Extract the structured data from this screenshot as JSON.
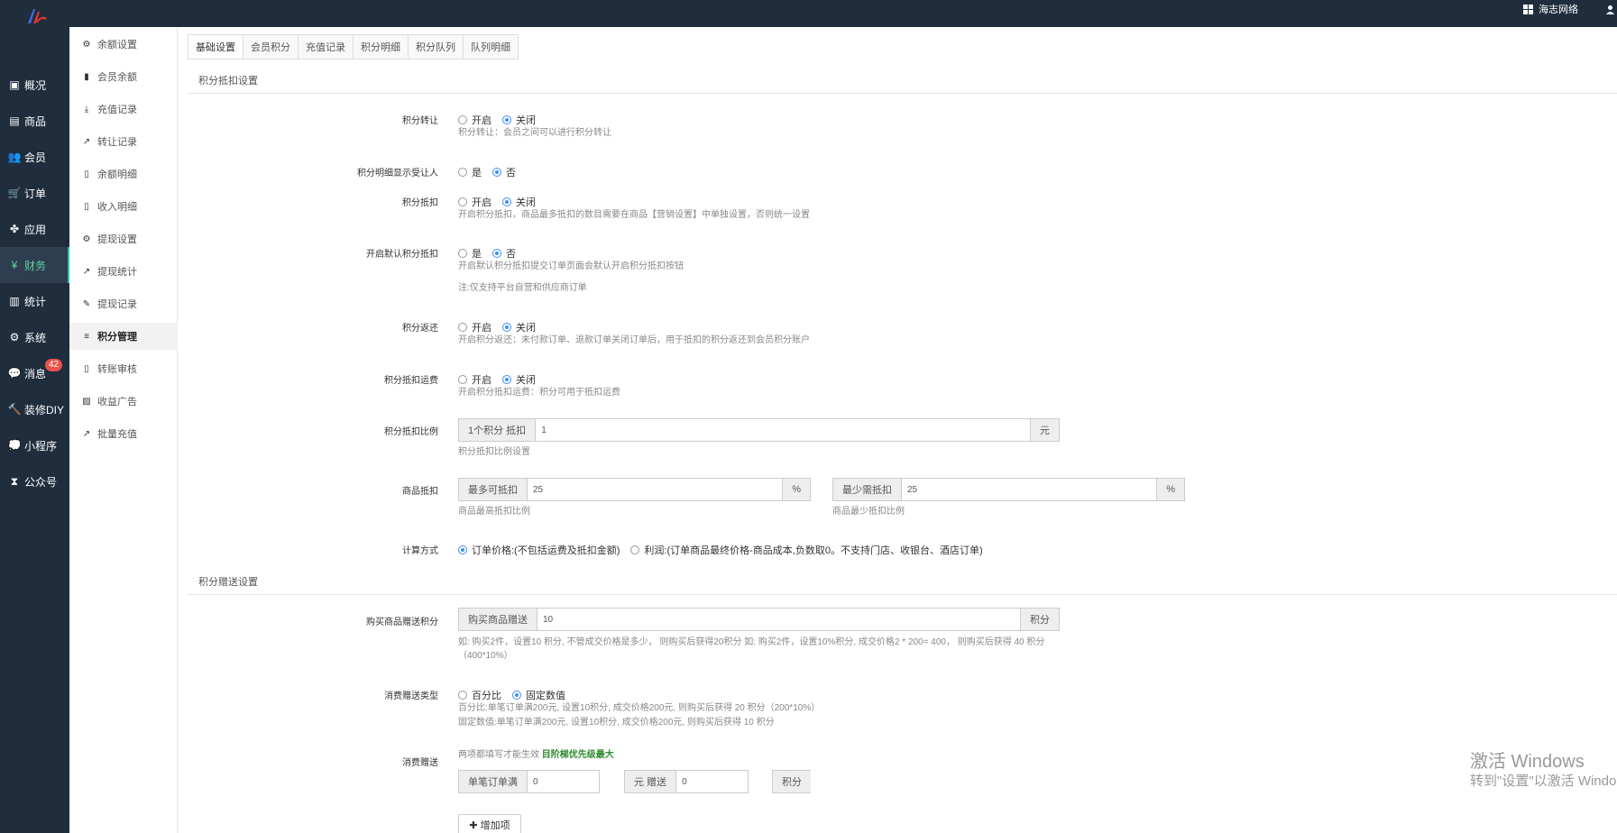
{
  "topbar": {
    "brand_link": "海志网络"
  },
  "nav": [
    {
      "label": "概况",
      "icon": "dashboard-icon"
    },
    {
      "label": "商品",
      "icon": "goods-icon"
    },
    {
      "label": "会员",
      "icon": "users-icon"
    },
    {
      "label": "订单",
      "icon": "cart-icon"
    },
    {
      "label": "应用",
      "icon": "apps-icon"
    },
    {
      "label": "财务",
      "icon": "yen-icon"
    },
    {
      "label": "统计",
      "icon": "chart-icon"
    },
    {
      "label": "系统",
      "icon": "cogs-icon"
    },
    {
      "label": "消息",
      "icon": "message-icon",
      "badge": "42"
    },
    {
      "label": "装修DIY",
      "icon": "hammer-icon"
    },
    {
      "label": "小程序",
      "icon": "wechat-icon"
    },
    {
      "label": "公众号",
      "icon": "hourglass-icon"
    }
  ],
  "subnav": [
    {
      "label": "余额设置",
      "icon": "gear-icon"
    },
    {
      "label": "会员余额",
      "icon": "book-icon"
    },
    {
      "label": "充值记录",
      "icon": "download-icon"
    },
    {
      "label": "转让记录",
      "icon": "external-link-icon"
    },
    {
      "label": "余额明细",
      "icon": "file-icon"
    },
    {
      "label": "收入明细",
      "icon": "file-icon"
    },
    {
      "label": "提现设置",
      "icon": "gear-icon"
    },
    {
      "label": "提现统计",
      "icon": "line-chart-icon"
    },
    {
      "label": "提现记录",
      "icon": "pencil-icon"
    },
    {
      "label": "积分管理",
      "icon": "database-icon"
    },
    {
      "label": "转账审核",
      "icon": "file-icon"
    },
    {
      "label": "收益广告",
      "icon": "image-icon"
    },
    {
      "label": "批量充值",
      "icon": "line-chart-icon"
    }
  ],
  "tabs": [
    "基础设置",
    "会员积分",
    "充值记录",
    "积分明细",
    "积分队列",
    "队列明细"
  ],
  "section1": "积分抵扣设置",
  "section2": "积分赠送设置",
  "form": {
    "transfer": {
      "label": "积分转让",
      "opt1": "开启",
      "opt2": "关闭",
      "help": "积分转让：会员之间可以进行积分转让"
    },
    "show_recipient": {
      "label": "积分明细显示受让人",
      "opt1": "是",
      "opt2": "否"
    },
    "deduct": {
      "label": "积分抵扣",
      "opt1": "开启",
      "opt2": "关闭",
      "help": "开启积分抵扣，商品最多抵扣的数目需要在商品【营销设置】中单独设置，否则统一设置"
    },
    "default_deduct": {
      "label": "开启默认积分抵扣",
      "opt1": "是",
      "opt2": "否",
      "help": "开启默认积分抵扣提交订单页面会默认开启积分抵扣按钮",
      "note": "注:仅支持平台自营和供应商订单"
    },
    "refund": {
      "label": "积分返还",
      "opt1": "开启",
      "opt2": "关闭",
      "help": "开启积分返还：未付款订单、退款订单关闭订单后，用于抵扣的积分返还到会员积分账户"
    },
    "freight": {
      "label": "积分抵扣运费",
      "opt1": "开启",
      "opt2": "关闭",
      "help": "开启积分抵扣运费：积分可用于抵扣运费"
    },
    "ratio": {
      "label": "积分抵扣比例",
      "prefix": "1个积分 抵扣",
      "value": "1",
      "suffix": "元",
      "help": "积分抵扣比例设置"
    },
    "goods_deduct": {
      "label": "商品抵扣",
      "max_prefix": "最多可抵扣",
      "max_value": "25",
      "max_suffix": "%",
      "max_help": "商品最高抵扣比例",
      "min_prefix": "最少需抵扣",
      "min_value": "25",
      "min_suffix": "%",
      "min_help": "商品最少抵扣比例"
    },
    "calc": {
      "label": "计算方式",
      "opt1": "订单价格:(不包括运费及抵扣金额)",
      "opt2": "利润:(订单商品最终价格-商品成本,负数取0。不支持门店、收银台、酒店订单)"
    },
    "buy_gift": {
      "label": "购买商品赠送积分",
      "prefix": "购买商品赠送",
      "value": "10",
      "suffix": "积分",
      "help1": "如: 购买2件，设置10 积分, 不管成交价格是多少， 则购买后获得20积分 如: 购买2件，设置10%积分, 成交价格2 * 200= 400， 则购买后获得 40 积分",
      "help2": "（400*10%）"
    },
    "gift_type": {
      "label": "消费赠送类型",
      "opt1": "百分比",
      "opt2": "固定数值",
      "help1": "百分比:单笔订单满200元, 设置10积分, 成交价格200元, 则购买后获得 20 积分（200*10%）",
      "help2": "固定数值:单笔订单满200元, 设置10积分, 成交价格200元, 则购买后获得 10 积分"
    },
    "consume_gift": {
      "label": "消费赠送",
      "help_a": "两项都填写才能生效",
      "help_b": "目阶梯优先级最大",
      "p1": "单笔订单满",
      "v1": "0",
      "p2": "元 赠送",
      "v2": "0",
      "p3": "积分",
      "add_btn": "增加项"
    }
  },
  "watermark": {
    "line1": "激活 Windows",
    "line2": "转到\"设置\"以激活 Windo"
  },
  "colors": {
    "sidebar": "#1f2d3d",
    "accent": "#1ecb9a",
    "radio": "#3e8ef7"
  }
}
